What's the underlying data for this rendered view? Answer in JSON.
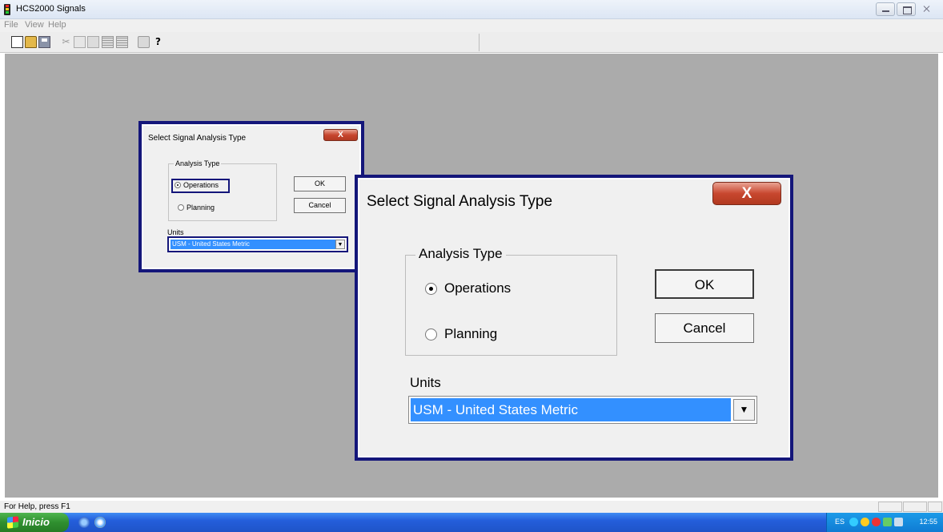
{
  "window": {
    "title": "HCS2000 Signals"
  },
  "menu": {
    "items": [
      "File",
      "View",
      "Help"
    ]
  },
  "toolbar": {
    "icons": [
      "new-file-icon",
      "open-folder-icon",
      "save-icon",
      "cut-icon",
      "copy-icon",
      "paste-icon",
      "grid-icon",
      "table-icon",
      "print-icon",
      "help-icon"
    ]
  },
  "dialog": {
    "title": "Select Signal Analysis Type",
    "close_label": "X",
    "group_label": "Analysis Type",
    "options": [
      {
        "label": "Operations",
        "selected": true
      },
      {
        "label": "Planning",
        "selected": false
      }
    ],
    "ok_label": "OK",
    "cancel_label": "Cancel",
    "units_label": "Units",
    "units_value": "USM - United States Metric"
  },
  "statusbar": {
    "text": "For Help, press F1"
  },
  "taskbar": {
    "start_label": "Inicio",
    "language": "ES",
    "clock": "12:55"
  },
  "colors": {
    "highlight_border": "#14167a",
    "selection": "#3390ff",
    "workspace": "#ababab",
    "close_button": "#c7462e"
  }
}
